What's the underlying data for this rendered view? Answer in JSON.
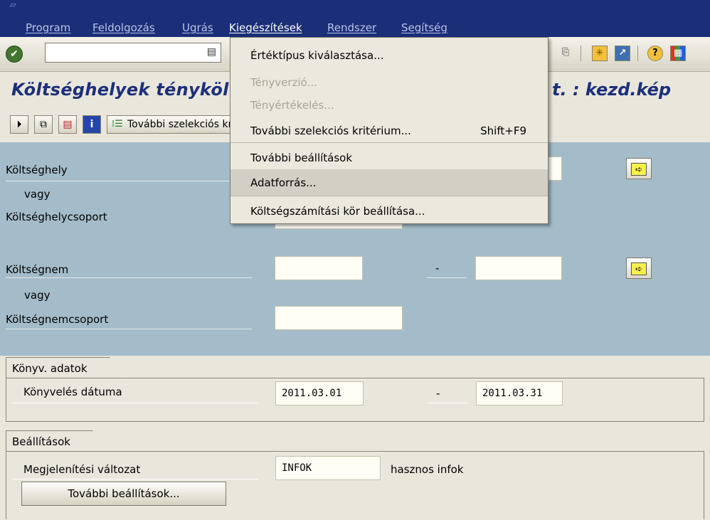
{
  "menubar": {
    "items": [
      "Program",
      "Feldolgozás",
      "Ugrás",
      "Kiegészítések",
      "Rendszer",
      "Segítség"
    ]
  },
  "title": {
    "left": "Költséghelyek tényköl",
    "right": "t. : kezd.kép"
  },
  "app_toolbar": {
    "more_selection_label": "További szelekciós kritérium"
  },
  "selection": {
    "cost_center_label": "Költséghely",
    "or1": "vagy",
    "cost_center_group_label": "Költséghelycsoport",
    "cost_element_label": "Költségnem",
    "or2": "vagy",
    "cost_element_group_label": "Költségnemcsoport",
    "range_dash": "-"
  },
  "posting_group": {
    "title": "Könyv. adatok",
    "posting_date_label": "Könyvelés dátuma",
    "date_from": "2011.03.01",
    "date_dash": "-",
    "date_to": "2011.03.31"
  },
  "settings_group": {
    "title": "Beállítások",
    "layout_label": "Megjelenítési változat",
    "layout_value": "INFOK",
    "layout_desc": "hasznos infok",
    "more_settings_button": "További beállítások..."
  },
  "dropdown": {
    "items": [
      {
        "label": "Értéktípus kiválasztása...",
        "enabled": true
      },
      {
        "label": "Tényverzió...",
        "enabled": false
      },
      {
        "label": "Tényértékelés...",
        "enabled": false
      },
      {
        "label": "További szelekciós kritérium...",
        "shortcut": "Shift+F9",
        "enabled": true
      },
      {
        "label": "További beállítások",
        "enabled": true
      },
      {
        "label": "Adatforrás...",
        "enabled": true,
        "highlighted": true
      },
      {
        "label": "Költségszámítási kör beállítása...",
        "enabled": true
      }
    ]
  },
  "colors": {
    "menubar_bg": "#1b2e78",
    "title_color": "#1c2f7a",
    "selection_bg": "#a4bcc9",
    "screen_bg": "#e9e6dc"
  }
}
